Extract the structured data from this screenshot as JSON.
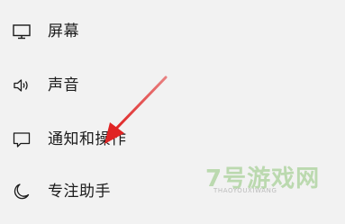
{
  "nav": {
    "items": [
      {
        "label": "屏幕",
        "icon": "monitor-icon"
      },
      {
        "label": "声音",
        "icon": "speaker-icon"
      },
      {
        "label": "通知和操作",
        "icon": "notification-icon"
      },
      {
        "label": "专注助手",
        "icon": "moon-icon"
      }
    ]
  },
  "annotation": {
    "arrow_color": "#e02424"
  },
  "watermark": {
    "title": "7号游戏网",
    "subtitle": "THAOYOUXIWANG"
  }
}
